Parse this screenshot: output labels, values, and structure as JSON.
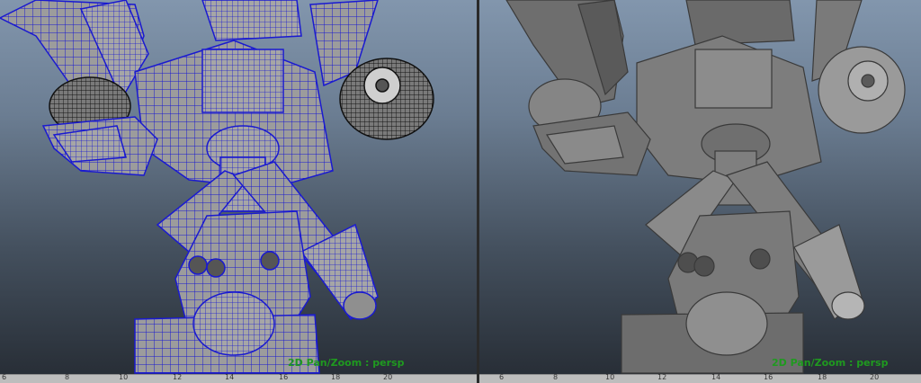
{
  "viewports": [
    {
      "id": "left",
      "mode": "wireframe-on-shaded",
      "label": "2D Pan/Zoom : persp",
      "ruler_ticks": [
        "6",
        "8",
        "10",
        "12",
        "14",
        "16",
        "18",
        "20"
      ]
    },
    {
      "id": "right",
      "mode": "smooth-shaded",
      "label": "2D Pan/Zoom : persp",
      "ruler_ticks": [
        "6",
        "8",
        "10",
        "12",
        "14",
        "16",
        "18",
        "20"
      ]
    }
  ],
  "colors": {
    "wire": "#1a1ad0",
    "wire_dark": "#111111",
    "shade_light": "#8a8a8a",
    "shade_mid": "#6b6b6b",
    "shade_dark": "#3a3a3a",
    "hud_text": "#1f9a1f",
    "bg_top": "#8296ad",
    "bg_bottom": "#262c34"
  }
}
